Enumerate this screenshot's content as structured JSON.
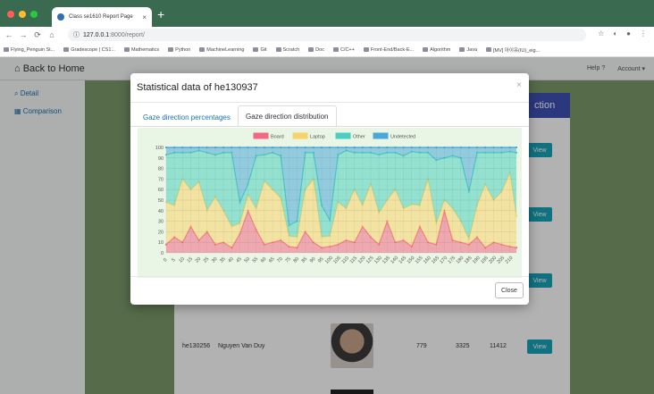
{
  "browser": {
    "tab_title": "Class se1610 Report Page",
    "new_tab": "+",
    "url_host": "127.0.0.1",
    "url_path": ":8000/report/",
    "bookmarks": [
      "Flying_Penguin St...",
      "Gradescope | CS1...",
      "Mathematics",
      "Python",
      "MachineLearning",
      "Git",
      "Scratch",
      "Doc",
      "C/C++",
      "Front-End/Back-E...",
      "Algorithm",
      "Java",
      "[MV] 아이유(IU)_eig..."
    ]
  },
  "app": {
    "back_label": "Back to Home",
    "help_label": "Help",
    "account_label": "Account",
    "sidebar": [
      "Detail",
      "Comparison"
    ],
    "action_header": "ction",
    "view_label": "View",
    "row": {
      "id": "he130256",
      "name": "Nguyen Van Duy",
      "c1": "779",
      "c2": "3325",
      "c3": "11412"
    }
  },
  "modal": {
    "title": "Statistical data of he130937",
    "close_x": "×",
    "tabs": [
      "Gaze direction percentages",
      "Gaze direction distribution"
    ],
    "close_label": "Close"
  },
  "colors": {
    "board": "#f06a85",
    "laptop": "#f7d36b",
    "other": "#4ccfc0",
    "undetected": "#4aa8d8",
    "chart_bg": "#eaf6e5",
    "action_blue": "#3f51b5",
    "view_teal": "#17a2b8"
  },
  "chart_data": {
    "type": "area",
    "stacked": true,
    "legend_position": "top",
    "grid": true,
    "ylim": [
      0,
      100
    ],
    "yticks": [
      0,
      10,
      20,
      30,
      40,
      50,
      60,
      70,
      80,
      90,
      100
    ],
    "xlim": [
      0,
      214
    ],
    "xticks": [
      0,
      5,
      10,
      15,
      20,
      25,
      30,
      35,
      40,
      45,
      50,
      55,
      60,
      65,
      70,
      75,
      80,
      85,
      90,
      95,
      100,
      105,
      110,
      115,
      120,
      125,
      130,
      135,
      140,
      145,
      150,
      155,
      160,
      165,
      170,
      175,
      180,
      185,
      190,
      195,
      200,
      205,
      210
    ],
    "x": [
      0,
      5,
      10,
      15,
      20,
      25,
      30,
      35,
      40,
      45,
      50,
      55,
      60,
      65,
      70,
      75,
      80,
      85,
      90,
      95,
      100,
      105,
      110,
      115,
      120,
      125,
      130,
      135,
      140,
      145,
      150,
      155,
      160,
      165,
      170,
      175,
      180,
      185,
      190,
      195,
      200,
      205,
      210,
      214
    ],
    "series": [
      {
        "name": "Board",
        "color": "#f06a85",
        "values": [
          8,
          15,
          10,
          25,
          12,
          20,
          8,
          10,
          5,
          18,
          40,
          22,
          8,
          10,
          12,
          6,
          5,
          20,
          10,
          5,
          6,
          8,
          12,
          10,
          25,
          15,
          8,
          30,
          10,
          12,
          6,
          25,
          10,
          8,
          40,
          12,
          10,
          8,
          15,
          5,
          10,
          8,
          6,
          5
        ]
      },
      {
        "name": "Laptop",
        "color": "#f7d36b",
        "values": [
          40,
          30,
          60,
          35,
          55,
          20,
          45,
          30,
          20,
          10,
          15,
          20,
          60,
          50,
          40,
          10,
          10,
          40,
          60,
          10,
          10,
          40,
          30,
          50,
          20,
          50,
          30,
          20,
          50,
          30,
          40,
          20,
          60,
          20,
          10,
          30,
          20,
          5,
          30,
          60,
          40,
          50,
          70,
          30
        ]
      },
      {
        "name": "Other",
        "color": "#4ccfc0",
        "values": [
          45,
          50,
          25,
          35,
          30,
          55,
          40,
          55,
          70,
          20,
          10,
          50,
          25,
          35,
          40,
          10,
          15,
          35,
          25,
          30,
          15,
          45,
          55,
          35,
          50,
          30,
          55,
          45,
          35,
          50,
          50,
          50,
          25,
          60,
          40,
          50,
          60,
          45,
          50,
          30,
          45,
          37,
          20,
          60
        ]
      },
      {
        "name": "Undetected",
        "color": "#4aa8d8",
        "values": [
          7,
          5,
          5,
          5,
          3,
          5,
          7,
          5,
          5,
          52,
          35,
          8,
          7,
          5,
          8,
          74,
          70,
          5,
          5,
          55,
          69,
          7,
          3,
          5,
          5,
          5,
          7,
          5,
          5,
          8,
          4,
          5,
          5,
          12,
          10,
          8,
          10,
          42,
          5,
          5,
          5,
          5,
          4,
          5
        ]
      }
    ]
  }
}
